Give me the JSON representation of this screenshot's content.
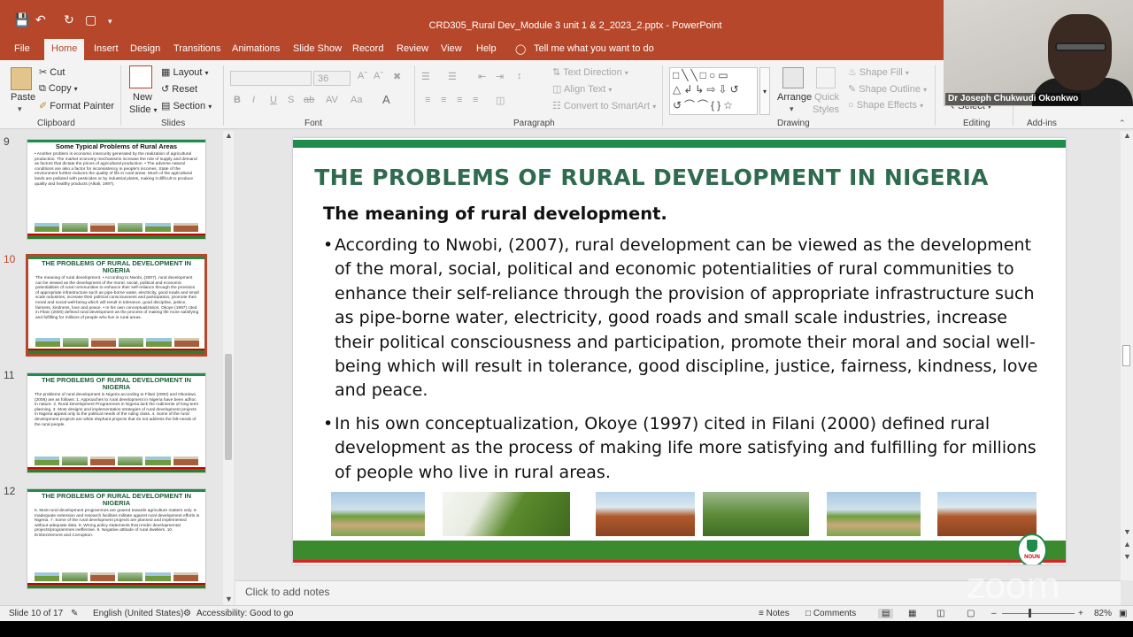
{
  "window": {
    "title": "CRD305_Rural Dev_Module 3 unit 1 & 2_2023_2.pptx - PowerPoint"
  },
  "ribbon_tabs": [
    "File",
    "Home",
    "Insert",
    "Design",
    "Transitions",
    "Animations",
    "Slide Show",
    "Record",
    "Review",
    "View",
    "Help",
    "Tell me what you want to do"
  ],
  "clipboard": {
    "paste": "Paste",
    "cut": "Cut",
    "copy": "Copy",
    "format_painter": "Format Painter",
    "group": "Clipboard"
  },
  "slides_group": {
    "new_slide_1": "New",
    "new_slide_2": "Slide",
    "layout": "Layout",
    "reset": "Reset",
    "section": "Section",
    "group": "Slides"
  },
  "font_group": {
    "size": "36",
    "group": "Font",
    "bold": "B",
    "italic": "I",
    "underline": "U",
    "strike": "S",
    "shadow": "ab"
  },
  "paragraph_group": {
    "text_direction": "Text Direction",
    "align_text": "Align Text",
    "convert_smartart": "Convert to SmartArt",
    "group": "Paragraph"
  },
  "drawing_group": {
    "arrange": "Arrange",
    "quick_styles_1": "Quick",
    "quick_styles_2": "Styles",
    "shape_fill": "Shape Fill",
    "shape_outline": "Shape Outline",
    "shape_effects": "Shape Effects",
    "group": "Drawing"
  },
  "editing_group": {
    "select": "Select",
    "group": "Editing"
  },
  "addins_group": {
    "group": "Add-ins"
  },
  "webcam": {
    "name": "Dr Joseph Chukwudi Okonkwo"
  },
  "thumbnails": [
    {
      "num": "9",
      "title": "Some Typical Problems of Rural Areas",
      "body": "• Another problem is economic insecurity generated by the realization of agricultural production. The market economy mechanisms increase the role of supply and demand as factors that dictate the prices of agricultural production. • The adverse natural conditions are also a factor for inconsistency in people's incomes. State of the environment further reduces the quality of life in rural areas. Much of the agricultural lands are polluted with pesticides or by industrial plants, making it difficult to produce quality and healthy products (Alkali, 1997)."
    },
    {
      "num": "10",
      "title": "THE PROBLEMS OF RURAL DEVELOPMENT IN NIGERIA",
      "body": "The meaning of rural development. • According to Nwobi, (2007), rural development can be viewed as the development of the moral, social, political and economic potentialities of rural communities to enhance their self-reliance through the provision of appropriate infrastructure such as pipe-borne water, electricity, good roads and small scale industries, increase their political consciousness and participation, promote their moral and social well-being which will result in tolerance, good discipline, justice, fairness, kindness, love and peace. • In his own conceptualization, Okoye (1997) cited in Filani (2000) defined rural development as the process of making life more satisfying and fulfilling for millions of people who live in rural areas."
    },
    {
      "num": "11",
      "title": "THE PROBLEMS OF RURAL DEVELOPMENT IN NIGERIA",
      "body": "The problems of rural development in Nigeria according to Filani (2000) and Okonkwo (2006) are as follows: 1. Approaches to rural development in Nigeria have been adhoc in nature. 2. Rural Development Programmes in Nigeria lack the rudiments of long-term planning. 3. Most designs and implementation strategies of rural development projects in Nigeria appeal only to the political needs of the ruling class. 4. Some of the rural development projects are white elephant projects that do not address the felt-needs of the rural people."
    },
    {
      "num": "12",
      "title": "THE PROBLEMS OF RURAL DEVELOPMENT IN NIGERIA",
      "body": "5. Most rural development programmes are geared towards agriculture matters only. 6. Inadequate extension and research facilities militate against rural development efforts in Nigeria. 7. Some of the rural development projects are planned and implemented without adequate data. 8. Wrong policy statements that render developmental projects/programmes ineffective. 9. Negative attitude of rural dwellers. 10. Embezzlement and Corruption."
    }
  ],
  "slide": {
    "title": "THE PROBLEMS OF RURAL DEVELOPMENT IN NIGERIA",
    "subtitle": "The meaning of rural development.",
    "bullets": [
      "According to Nwobi, (2007), rural development can be viewed as the development of the moral, social, political and economic potentialities of rural communities to enhance their self-reliance through the provision of appropriate infrastructure such as pipe-borne water, electricity, good roads and small scale industries, increase their political consciousness and participation, promote their moral and social well-being which will result in tolerance, good discipline, justice, fairness, kindness, love and peace.",
      "In his own conceptualization, Okoye (1997) cited in Filani (2000) defined rural development as the process of making life more satisfying and fulfilling for millions of people who live in rural areas."
    ],
    "logo_text": "NOUN"
  },
  "notes": {
    "placeholder": "Click to add notes"
  },
  "status": {
    "slide": "Slide 10 of 17",
    "language": "English (United States)",
    "accessibility": "Accessibility: Good to go",
    "notes": "Notes",
    "comments": "Comments",
    "zoom": "82%"
  },
  "watermark": "zoom",
  "colors": {
    "accent": "#b7472a",
    "slide_title": "#2e6b4f",
    "slide_green": "#1f8b4c"
  }
}
